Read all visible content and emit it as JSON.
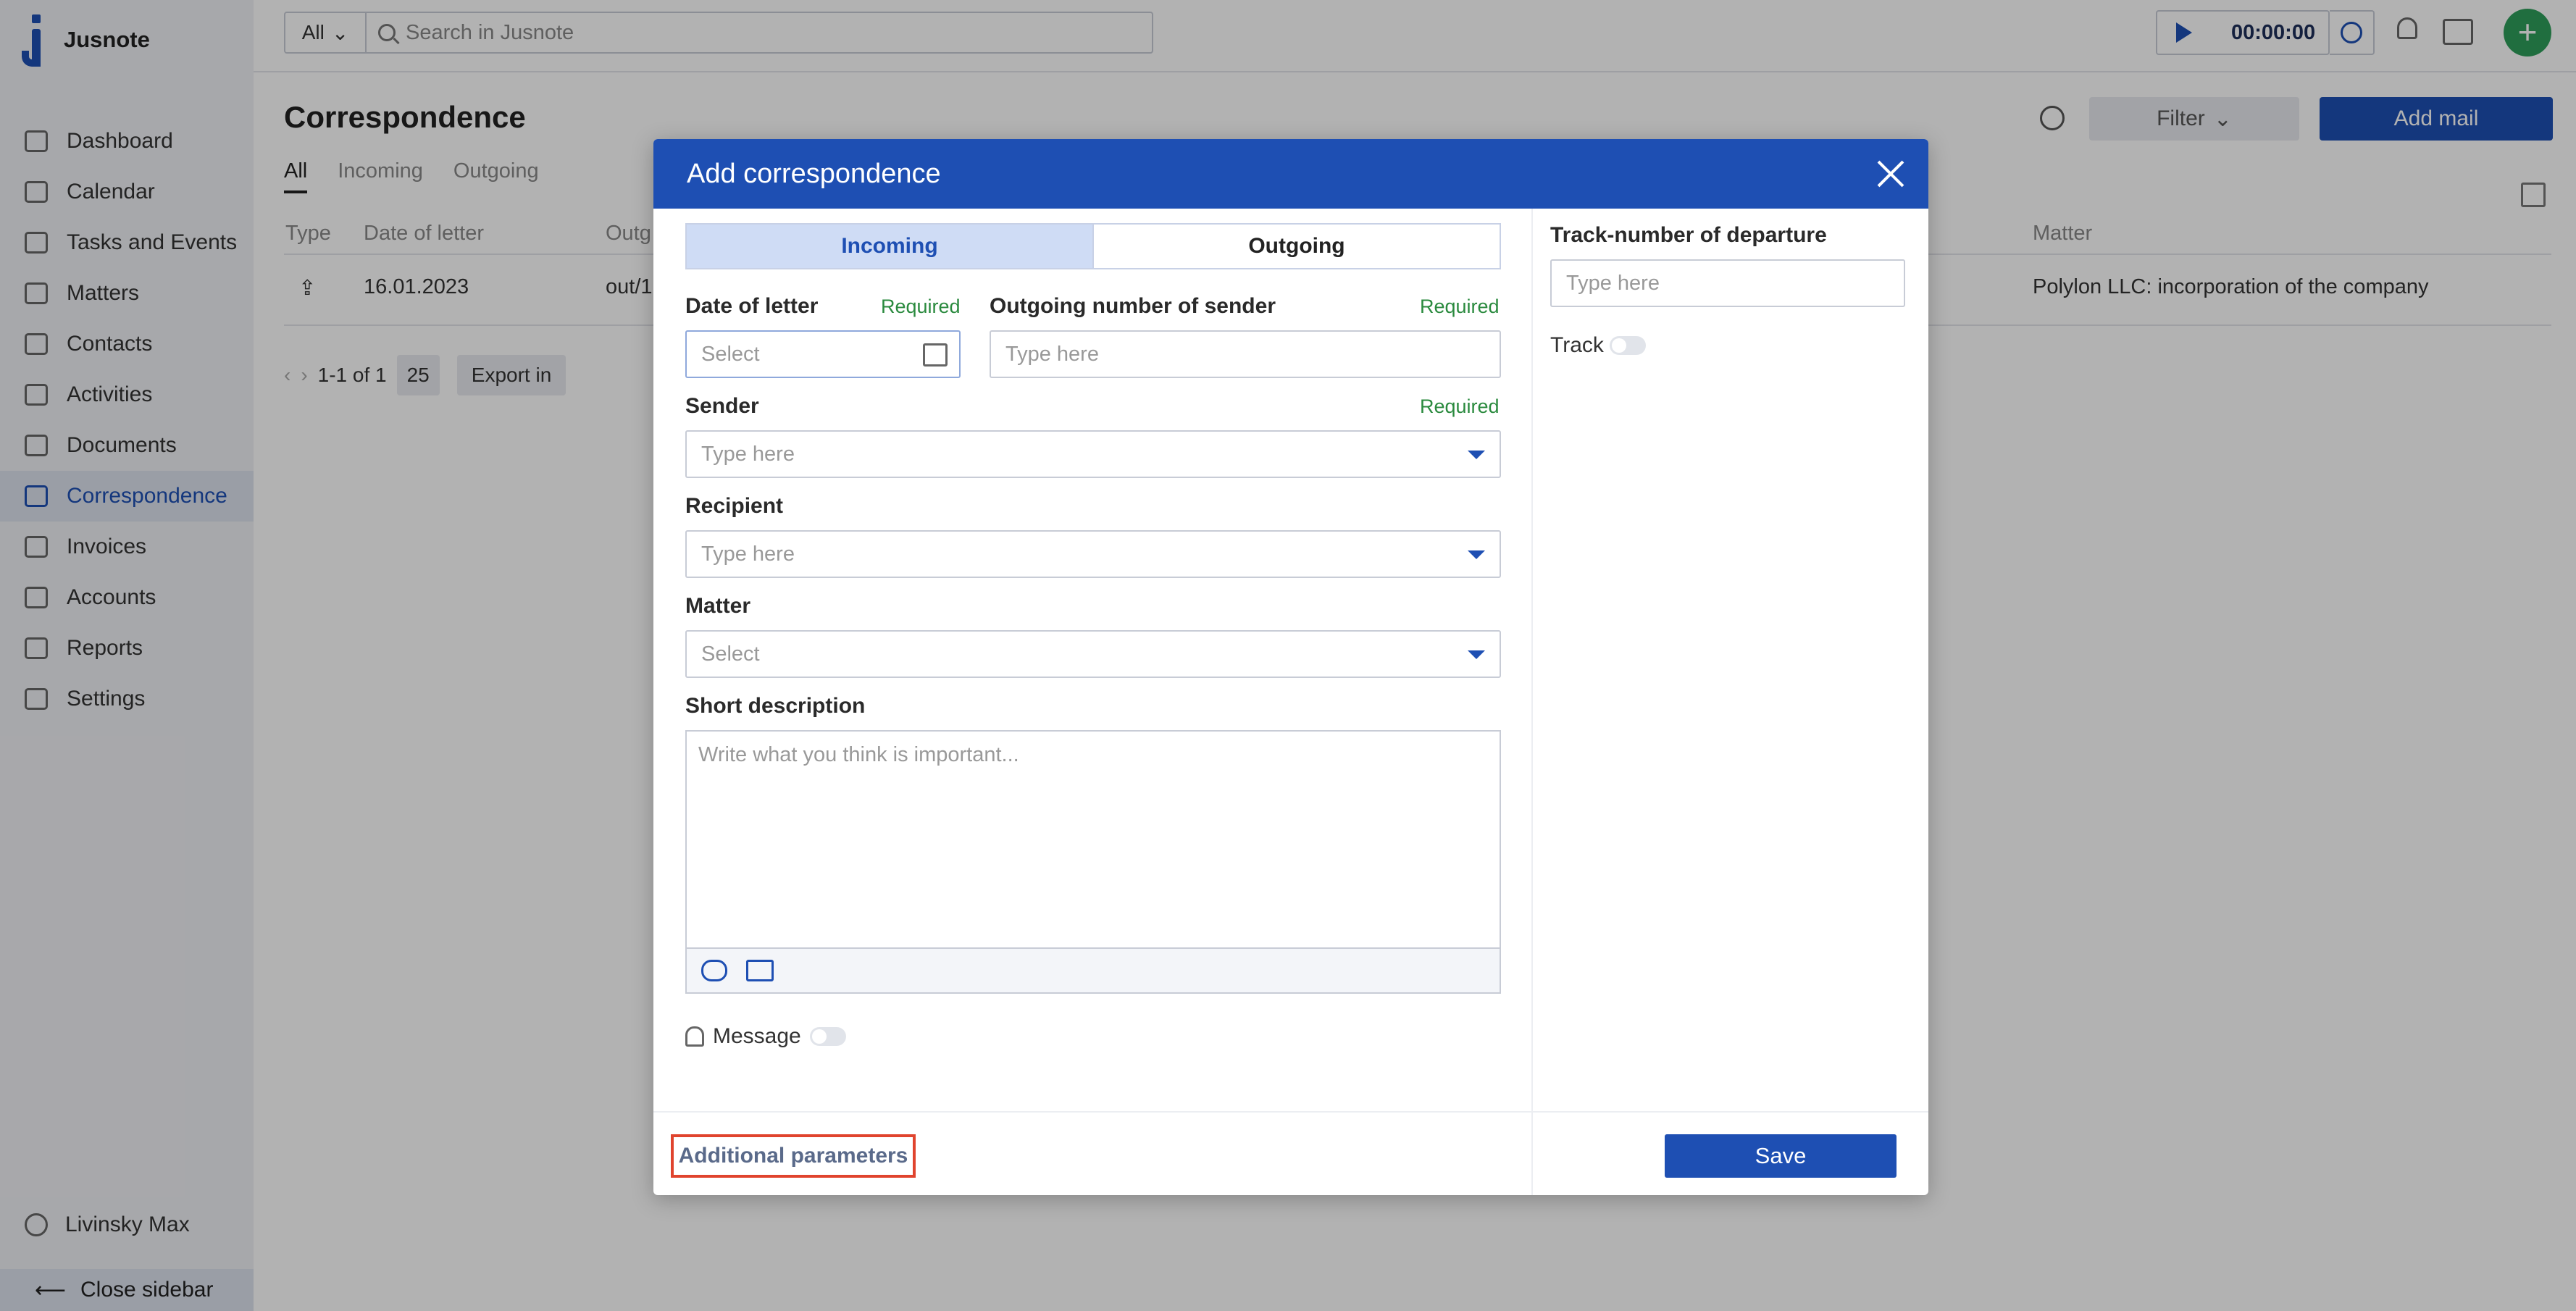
{
  "app": {
    "name": "Jusnote"
  },
  "sidebar": {
    "items": [
      {
        "label": "Dashboard",
        "icon": "home-icon"
      },
      {
        "label": "Calendar",
        "icon": "calendar-icon"
      },
      {
        "label": "Tasks and Events",
        "icon": "tasks-icon"
      },
      {
        "label": "Matters",
        "icon": "briefcase-icon"
      },
      {
        "label": "Contacts",
        "icon": "contacts-icon"
      },
      {
        "label": "Activities",
        "icon": "activities-icon"
      },
      {
        "label": "Documents",
        "icon": "documents-icon"
      },
      {
        "label": "Correspondence",
        "icon": "correspondence-icon",
        "active": true
      },
      {
        "label": "Invoices",
        "icon": "invoice-icon"
      },
      {
        "label": "Accounts",
        "icon": "accounts-icon"
      },
      {
        "label": "Reports",
        "icon": "reports-icon"
      },
      {
        "label": "Settings",
        "icon": "settings-icon"
      }
    ],
    "user": "Livinsky Max",
    "close_label": "Close sidebar"
  },
  "topbar": {
    "scope": "All",
    "search_placeholder": "Search in Jusnote",
    "timer": "00:00:00",
    "plus": "+"
  },
  "page": {
    "title": "Correspondence",
    "filter_label": "Filter",
    "add_label": "Add mail",
    "tabs": [
      "All",
      "Incoming",
      "Outgoing"
    ],
    "columns": {
      "type": "Type",
      "date": "Date of letter",
      "outgoing": "Outg",
      "matter": "Matter"
    },
    "row": {
      "date": "16.01.2023",
      "outgoing": "out/1",
      "matter": "Polylon LLC: incorporation of the company"
    },
    "pager": {
      "range": "1-1 of 1",
      "per_page": "25",
      "export": "Export in"
    }
  },
  "modal": {
    "title": "Add correspondence",
    "direction": [
      "Incoming",
      "Outgoing"
    ],
    "date_label": "Date of letter",
    "date_placeholder": "Select",
    "outnum_label": "Outgoing number of sender",
    "outnum_placeholder": "Type here",
    "required": "Required",
    "sender_label": "Sender",
    "sender_placeholder": "Type here",
    "recipient_label": "Recipient",
    "recipient_placeholder": "Type here",
    "matter_label": "Matter",
    "matter_placeholder": "Select",
    "desc_label": "Short description",
    "desc_placeholder": "Write what you think is important...",
    "message_label": "Message",
    "track_number_label": "Track-number of departure",
    "track_number_placeholder": "Type here",
    "track_label": "Track",
    "additional_label": "Additional parameters",
    "save_label": "Save"
  },
  "colors": {
    "accent": "#1e4fb3",
    "required": "#2a8a3e",
    "highlight": "#e0442e",
    "success": "#2e9e5b"
  }
}
